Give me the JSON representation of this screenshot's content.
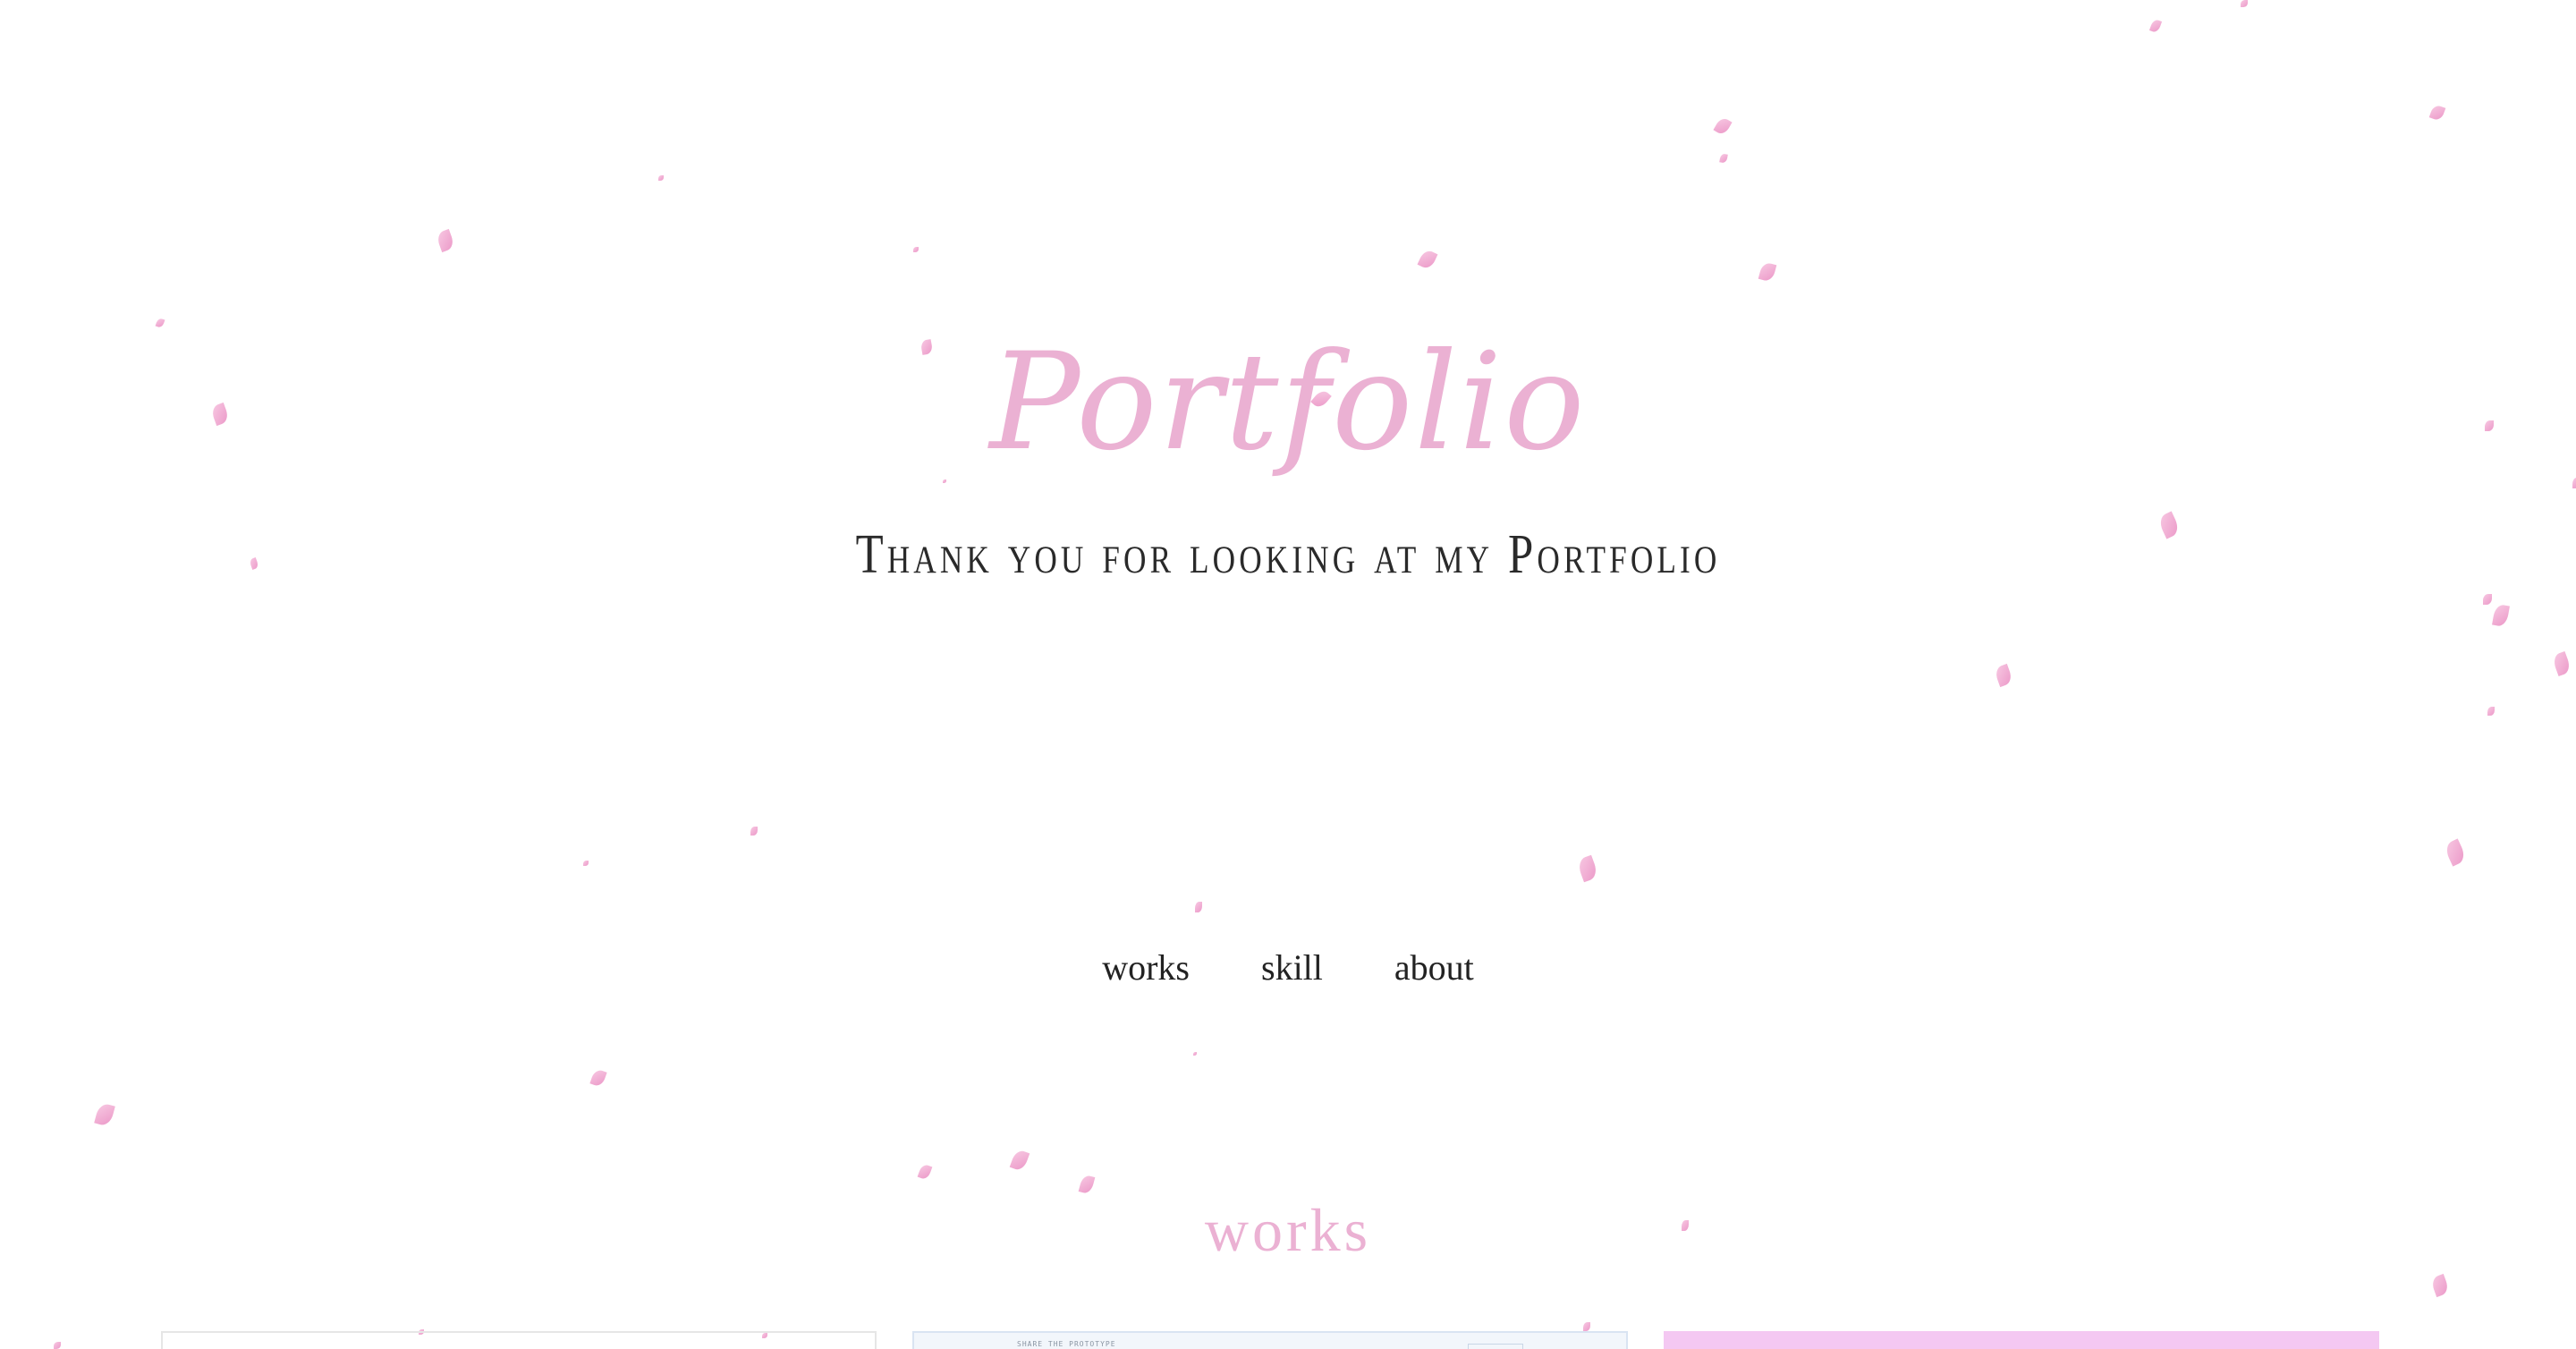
{
  "hero": {
    "title": "Portfolio",
    "subtitle": "Thank you for looking at my Portfolio"
  },
  "nav": {
    "items": [
      "works",
      "skill",
      "about"
    ]
  },
  "works_section": {
    "title": "works",
    "cards": [
      {
        "caption": ""
      },
      {
        "caption": "SHARE THE PROTOTYPE"
      },
      {
        "caption": ""
      }
    ]
  },
  "colors": {
    "accent_pink": "#ebb1d3",
    "petal_pink": "#e98cc1",
    "text_dark": "#222222",
    "background": "#ffffff"
  },
  "icons": {
    "petal": "cherry-blossom-petal-icon"
  }
}
